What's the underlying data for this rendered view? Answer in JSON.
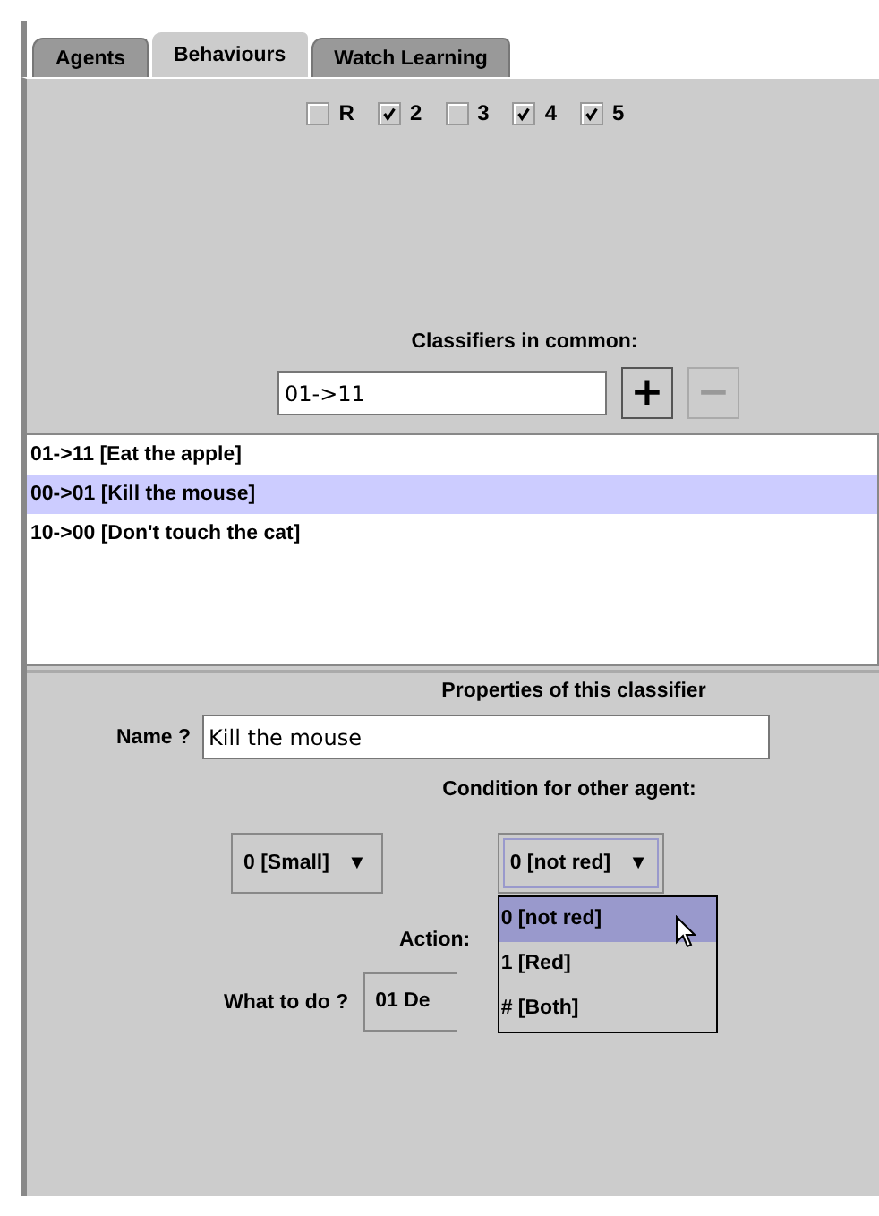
{
  "tabs": [
    {
      "label": "Agents",
      "selected": false
    },
    {
      "label": "Behaviours",
      "selected": true
    },
    {
      "label": "Watch Learning",
      "selected": false
    }
  ],
  "checkboxes": [
    {
      "label": "R",
      "checked": false
    },
    {
      "label": "2",
      "checked": true
    },
    {
      "label": "3",
      "checked": false
    },
    {
      "label": "4",
      "checked": true
    },
    {
      "label": "5",
      "checked": true
    }
  ],
  "classifiers_label": "Classifiers in common:",
  "classifier_field": {
    "value": "01->11"
  },
  "add_button": {
    "label": "+",
    "disabled": false
  },
  "remove_button": {
    "label": "−",
    "disabled": true
  },
  "classifiers": [
    {
      "label": "01->11 [Eat the apple]",
      "selected": false
    },
    {
      "label": "00->01 [Kill the mouse]",
      "selected": true
    },
    {
      "label": "10->00 [Don't touch the cat]",
      "selected": false
    }
  ],
  "properties_title": "Properties of this classifier",
  "name_label": "Name ?",
  "name_field": {
    "value": "Kill the mouse"
  },
  "condition_label": "Condition for other agent:",
  "condition_dropdowns": [
    {
      "value": "0 [Small]",
      "arrow": "▼",
      "open": false
    },
    {
      "value": "0 [not red]",
      "arrow": "▼",
      "open": true
    }
  ],
  "dropdown_options": [
    {
      "label": "0 [not red]",
      "selected": true
    },
    {
      "label": "1 [Red]",
      "selected": false
    },
    {
      "label": "# [Both]",
      "selected": false
    }
  ],
  "action_label": "Action:",
  "what_label": "What to do ?",
  "what_field": {
    "value": "01 De"
  }
}
